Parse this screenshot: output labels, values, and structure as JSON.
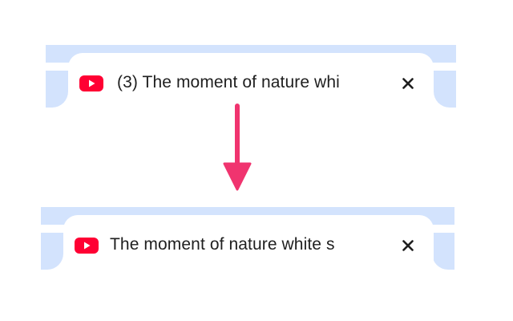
{
  "tab_before": {
    "title": "(3) The moment of nature whi",
    "favicon_icon": "youtube-icon",
    "close_icon": "close-icon"
  },
  "tab_after": {
    "title": "The moment of nature white s",
    "favicon_icon": "youtube-icon",
    "close_icon": "close-icon"
  },
  "arrow": {
    "icon": "arrow-down-icon",
    "color": "#f0346f"
  },
  "colors": {
    "tab_strip": "#d3e3fd",
    "tab": "#ffffff",
    "youtube_red": "#ff0033",
    "text": "#1f1f1f"
  }
}
